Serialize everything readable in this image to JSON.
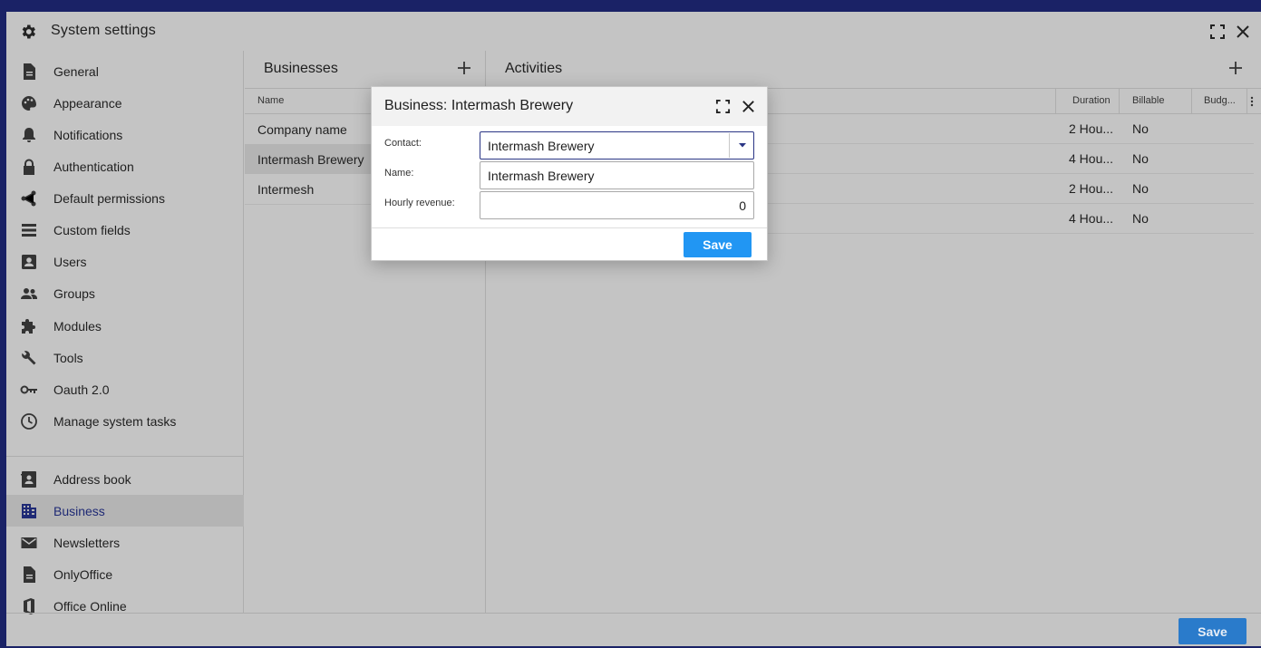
{
  "window": {
    "title": "System settings"
  },
  "sidebar": {
    "items": [
      {
        "label": "General",
        "icon": "document-icon"
      },
      {
        "label": "Appearance",
        "icon": "palette-icon"
      },
      {
        "label": "Notifications",
        "icon": "bell-icon"
      },
      {
        "label": "Authentication",
        "icon": "lock-icon"
      },
      {
        "label": "Default permissions",
        "icon": "share-icon"
      },
      {
        "label": "Custom fields",
        "icon": "list-icon"
      },
      {
        "label": "Users",
        "icon": "user-badge-icon"
      },
      {
        "label": "Groups",
        "icon": "group-icon"
      },
      {
        "label": "Modules",
        "icon": "puzzle-icon"
      },
      {
        "label": "Tools",
        "icon": "wrench-icon"
      },
      {
        "label": "Oauth 2.0",
        "icon": "key-icon"
      },
      {
        "label": "Manage system tasks",
        "icon": "clock-icon"
      }
    ],
    "modules": [
      {
        "label": "Address book",
        "icon": "address-book-icon"
      },
      {
        "label": "Business",
        "icon": "building-icon",
        "active": true
      },
      {
        "label": "Newsletters",
        "icon": "mail-icon"
      },
      {
        "label": "OnlyOffice",
        "icon": "document-icon"
      },
      {
        "label": "Office Online",
        "icon": "office-icon"
      }
    ]
  },
  "businesses": {
    "title": "Businesses",
    "column_name": "Name",
    "rows": [
      "Company name",
      "Intermash Brewery",
      "Intermesh"
    ],
    "selected_index": 1
  },
  "activities": {
    "title": "Activities",
    "columns": {
      "duration": "Duration",
      "billable": "Billable",
      "budget": "Budg..."
    },
    "rows": [
      {
        "duration": "2 Hou...",
        "billable": "No"
      },
      {
        "duration": "4 Hou...",
        "billable": "No"
      },
      {
        "duration": "2 Hou...",
        "billable": "No"
      },
      {
        "duration": "4 Hou...",
        "billable": "No"
      }
    ]
  },
  "dialog": {
    "title": "Business: Intermash Brewery",
    "contact_label": "Contact:",
    "contact_value": "Intermash Brewery",
    "name_label": "Name:",
    "name_value": "Intermash Brewery",
    "hourly_label": "Hourly revenue:",
    "hourly_value": "0",
    "save_label": "Save"
  },
  "footer": {
    "save_label": "Save"
  },
  "colors": {
    "accent": "#2196f3",
    "active_text": "#1f2a75",
    "background": "#1a2266"
  }
}
